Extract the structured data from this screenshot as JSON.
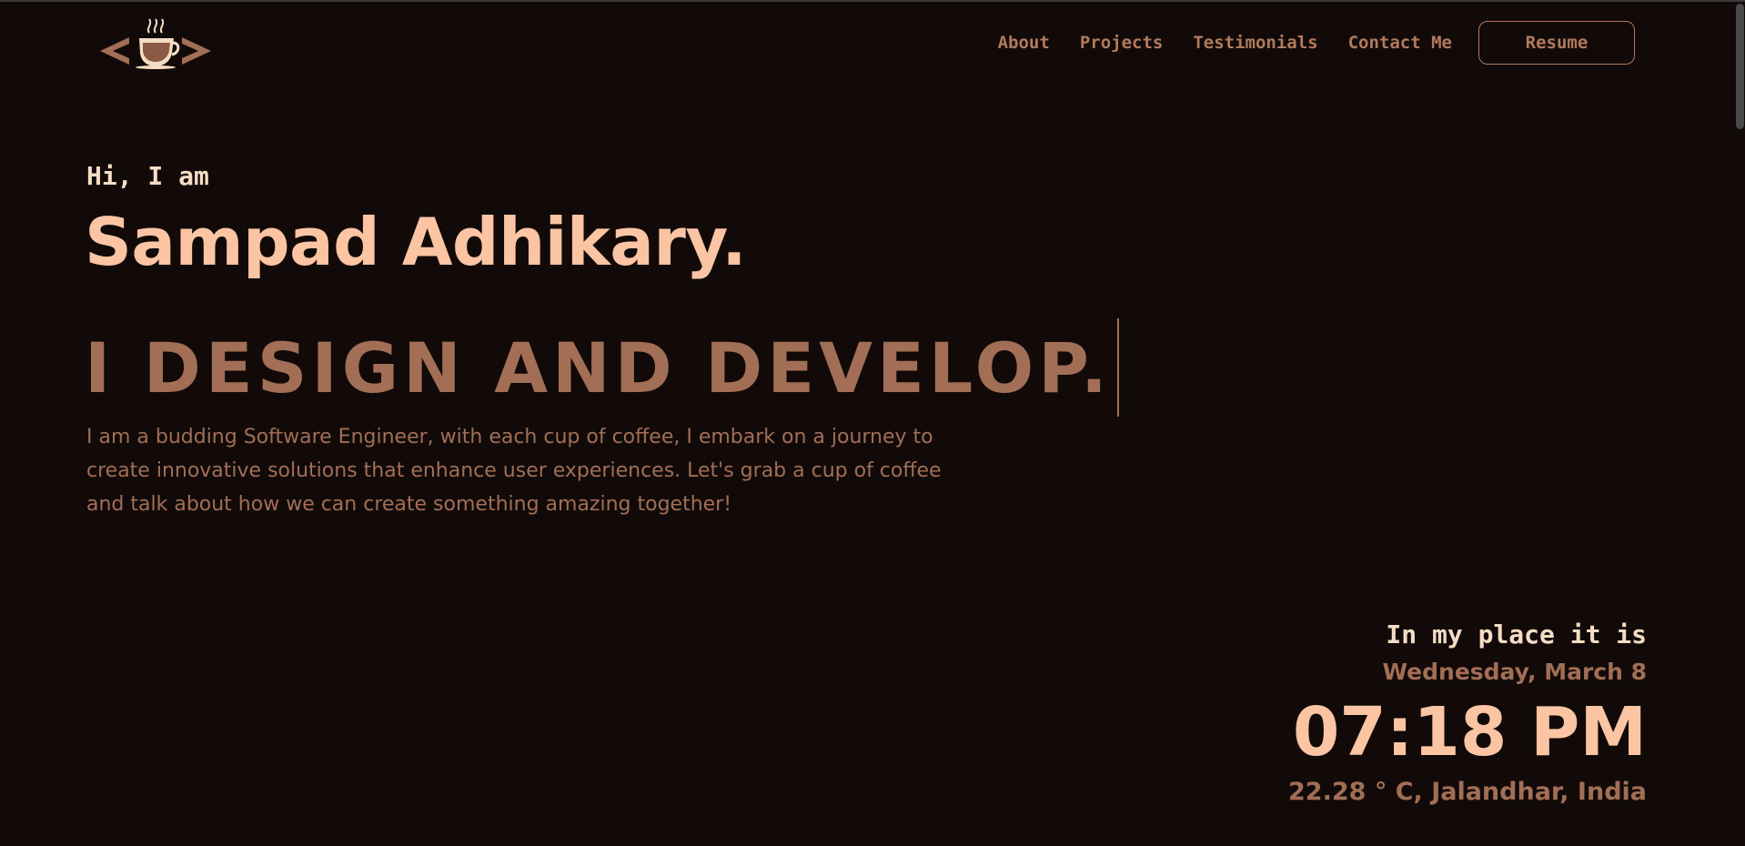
{
  "logo": {
    "icon": "coffee-cup-code-icon",
    "color": "#a26e55"
  },
  "nav": {
    "links": [
      "About",
      "Projects",
      "Testimonials",
      "Contact Me"
    ],
    "resume_label": "Resume"
  },
  "hero": {
    "greeting": "Hi, I am",
    "name": "Sampad Adhikary.",
    "tagline": "I DESIGN AND DEVELOP.",
    "bio": "I am a budding Software Engineer, with each cup of coffee, I embark on a journey to create innovative solutions that enhance user experiences. Let's grab a cup of coffee and talk about how we can create something amazing together!"
  },
  "clock": {
    "intro": "In my place it is",
    "date": "Wednesday, March 8",
    "time": "07:18 PM",
    "weather": "22.28 ° C, Jalandhar, India"
  },
  "colors": {
    "background": "#110a09",
    "accent": "#a26e55",
    "highlight": "#fbc4a3",
    "light_text": "#f5dcc4"
  }
}
